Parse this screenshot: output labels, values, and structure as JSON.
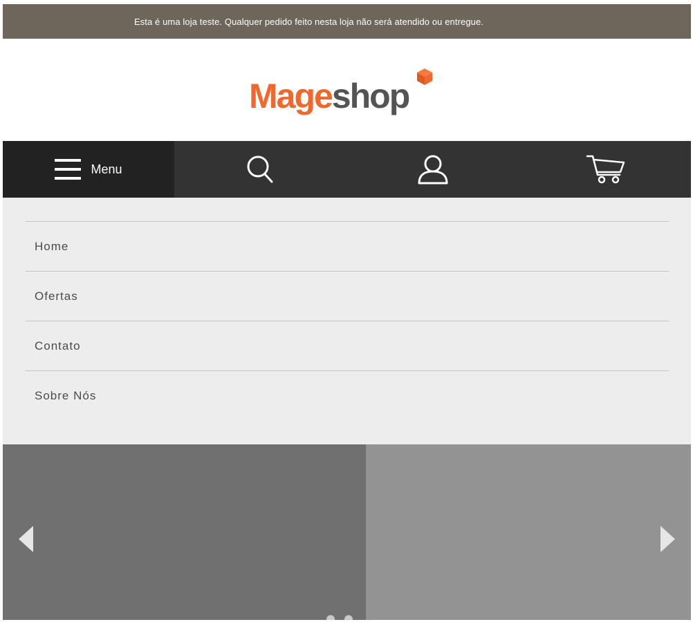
{
  "notice_bar": {
    "text": "Esta é uma loja teste. Qualquer pedido feito nesta loja não será atendido ou entregue."
  },
  "logo": {
    "part_1": "Mage",
    "part_2": "shop",
    "colors": {
      "orange": "#f0682d",
      "gray": "#545454"
    }
  },
  "nav": {
    "menu_label": "Menu",
    "icons": [
      "hamburger-icon",
      "search-icon",
      "user-icon",
      "cart-icon"
    ]
  },
  "menu": {
    "items": [
      {
        "label": "Home"
      },
      {
        "label": "Ofertas"
      },
      {
        "label": "Contato"
      },
      {
        "label": "Sobre Nós"
      }
    ]
  },
  "slider": {
    "icons": [
      "chevron-left-icon",
      "chevron-right-icon"
    ],
    "dot_count": 2
  },
  "colors": {
    "notice_bg": "#6e655b",
    "nav_bg": "#333333",
    "nav_menu_bg": "#222222",
    "menu_bg": "#ededed",
    "slide_left": "#707070",
    "slide_right": "#939393"
  }
}
